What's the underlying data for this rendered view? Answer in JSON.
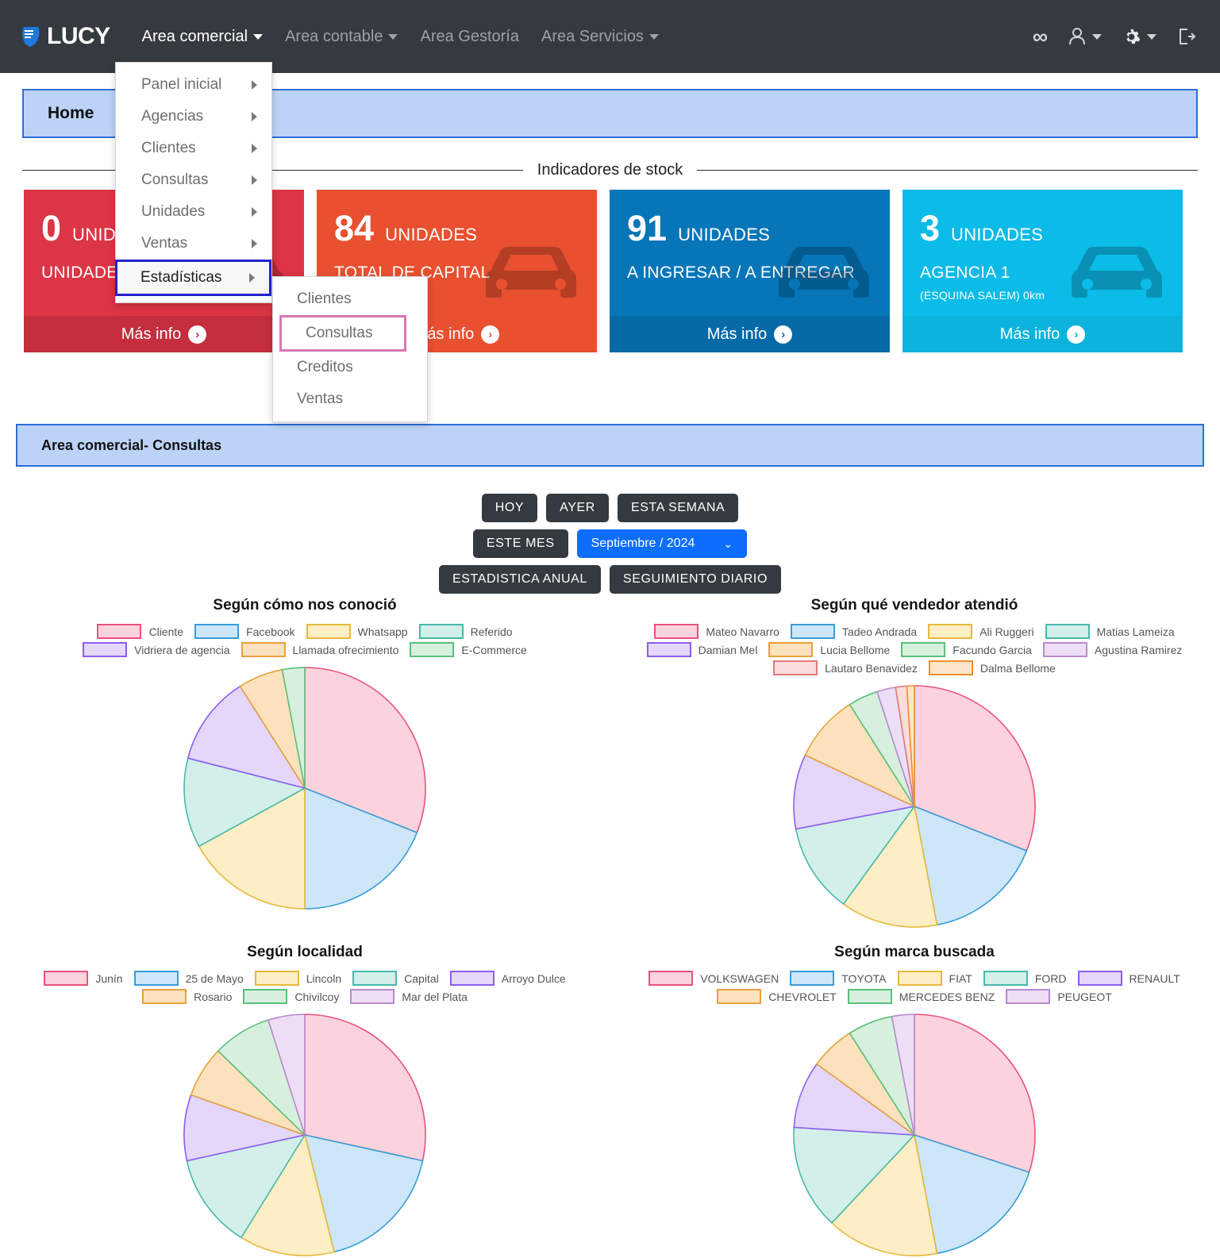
{
  "navbar": {
    "brand": "LUCY",
    "links": [
      {
        "label": "Area comercial",
        "caret": true,
        "active": true
      },
      {
        "label": "Area contable",
        "caret": true,
        "active": false
      },
      {
        "label": "Area Gestoría",
        "caret": false,
        "active": false
      },
      {
        "label": "Area Servicios",
        "caret": true,
        "active": false
      }
    ],
    "right_icons": [
      {
        "name": "infinity-icon",
        "glyph": "∞"
      },
      {
        "name": "user-icon",
        "glyph": "person"
      },
      {
        "name": "gear-icon",
        "glyph": "gear"
      },
      {
        "name": "logout-icon",
        "glyph": "logout"
      }
    ]
  },
  "menu_main": {
    "items": [
      {
        "label": "Panel inicial",
        "submenu": true,
        "highlight": "none"
      },
      {
        "label": "Agencias",
        "submenu": true,
        "highlight": "none"
      },
      {
        "label": "Clientes",
        "submenu": true,
        "highlight": "none"
      },
      {
        "label": "Consultas",
        "submenu": true,
        "highlight": "none"
      },
      {
        "label": "Unidades",
        "submenu": true,
        "highlight": "none"
      },
      {
        "label": "Ventas",
        "submenu": true,
        "highlight": "none"
      },
      {
        "label": "Estadísticas",
        "submenu": true,
        "highlight": "blue"
      }
    ]
  },
  "menu_sub": {
    "items": [
      {
        "label": "Clientes",
        "highlight": "none"
      },
      {
        "label": "Consultas",
        "highlight": "pink"
      },
      {
        "label": "Creditos",
        "highlight": "none"
      },
      {
        "label": "Ventas",
        "highlight": "none"
      }
    ]
  },
  "home_banner": {
    "title": "Home"
  },
  "page_banner": {
    "title": "Area comercial- Consultas"
  },
  "section": {
    "divider_label": "Indicadores de stock"
  },
  "cards": [
    {
      "value": "0",
      "unit": "UNIDADES",
      "label": "UNIDADES A",
      "sub": "",
      "more": "Más info",
      "color": "#dc3545",
      "foot": "#c42e3d"
    },
    {
      "value": "84",
      "unit": "UNIDADES",
      "label": "TOTAL DE CAPITAL",
      "sub": "",
      "more": "Más info",
      "color": "#e8502f",
      "foot": "#e8502f"
    },
    {
      "value": "91",
      "unit": "UNIDADES",
      "label": "A INGRESAR / A ENTREGAR",
      "sub": "",
      "more": "Más info",
      "color": "#0676b8",
      "foot": "#066aa6"
    },
    {
      "value": "3",
      "unit": "UNIDADES",
      "label": "AGENCIA 1",
      "sub": "(ESQUINA SALEM) 0km",
      "more": "Más info",
      "color": "#0bbbe8",
      "foot": "#0bb3dd"
    }
  ],
  "filters": {
    "row1": [
      "HOY",
      "AYER",
      "ESTA SEMANA"
    ],
    "row2_button": "ESTE MES",
    "month_select": {
      "value": "Septiembre / 2024"
    },
    "row3": [
      "ESTADISTICA ANUAL",
      "SEGUIMIENTO DIARIO"
    ]
  },
  "palette": {
    "fill": [
      "#fbd3dc",
      "#cde7f8",
      "#fdeec6",
      "#d2efea",
      "#e4d7fa",
      "#fbe2bd",
      "#d7f0dd",
      "#eedef5",
      "#f9dcdc",
      "#fde5cc"
    ],
    "stroke": [
      "#e8527e",
      "#3b9cd9",
      "#e8b93c",
      "#48b9ab",
      "#8e5cf0",
      "#e8a13c",
      "#59c07a",
      "#b98ad0",
      "#e07b7b",
      "#f09030"
    ]
  },
  "chart_data": [
    {
      "type": "pie",
      "title": "Según cómo nos conoció",
      "categories": [
        "Cliente",
        "Facebook",
        "Whatsapp",
        "Referido",
        "Vidriera de agencia",
        "Llamada ofrecimiento",
        "E-Commerce"
      ],
      "values": [
        31,
        19,
        17,
        12,
        12,
        6,
        3
      ],
      "legend_position": "top",
      "legend_rows": [
        5,
        2
      ]
    },
    {
      "type": "pie",
      "title": "Según qué vendedor atendió",
      "categories": [
        "Mateo Navarro",
        "Tadeo Andrada",
        "Ali Ruggeri",
        "Matias Lameiza",
        "Damian Mel",
        "Lucia Bellome",
        "Facundo Garcia",
        "Agustina Ramirez",
        "Lautaro Benavidez",
        "Dalma Bellome"
      ],
      "values": [
        31,
        16,
        13,
        12,
        10,
        9,
        4,
        2.5,
        1.5,
        1
      ],
      "legend_position": "top",
      "legend_rows": [
        4,
        4,
        2
      ]
    },
    {
      "type": "pie",
      "title": "Según localidad",
      "categories": [
        "Junín",
        "25 de Mayo",
        "Lincoln",
        "Capital",
        "Arroyo Dulce",
        "Rosario",
        "Chivilcoy",
        "Mar del Plata"
      ],
      "values": [
        29,
        18,
        13,
        13,
        9,
        7,
        8,
        5
      ],
      "legend_position": "top",
      "legend_rows": [
        5,
        3
      ]
    },
    {
      "type": "pie",
      "title": "Según marca buscada",
      "categories": [
        "VOLKSWAGEN",
        "TOYOTA",
        "FIAT",
        "FORD",
        "RENAULT",
        "CHEVROLET",
        "MERCEDES BENZ",
        "PEUGEOT"
      ],
      "values": [
        30,
        17,
        15,
        14,
        9,
        6,
        6,
        3
      ],
      "legend_position": "top",
      "legend_rows": [
        5,
        3
      ]
    }
  ]
}
